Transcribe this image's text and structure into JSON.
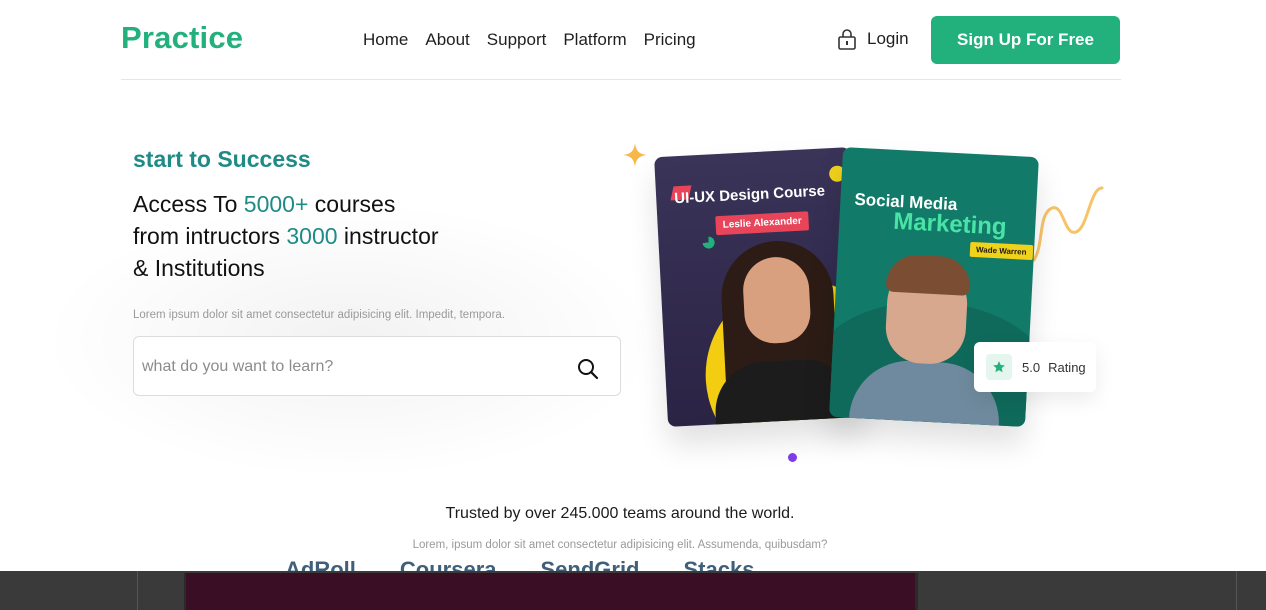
{
  "brand": {
    "logo": "Practice",
    "accent": "#22b07d",
    "teal": "#1f8b86"
  },
  "nav": {
    "items": [
      "Home",
      "About",
      "Support",
      "Platform",
      "Pricing"
    ]
  },
  "header": {
    "login_label": "Login",
    "signup_label": "Sign Up For Free"
  },
  "hero": {
    "tagline": "start to Success",
    "line1_prefix": "Access To ",
    "line1_highlight": "5000+",
    "line1_suffix": " courses",
    "line2_prefix": "from intructors ",
    "line2_highlight": "3000",
    "line2_suffix": " instructor",
    "line3": "& Institutions",
    "description": "Lorem ipsum dolor sit amet consectetur adipisicing elit. Impedit, tempora.",
    "search_placeholder": "what do you want to learn?"
  },
  "cards": [
    {
      "title": "UI-UX Design Course",
      "instructor": "Leslie Alexander"
    },
    {
      "title_line1": "Social Media",
      "title_line2": "Marketing",
      "instructor": "Wade Warren"
    }
  ],
  "rating": {
    "value": "5.0",
    "label": "Rating"
  },
  "trusted": {
    "headline": "Trusted by over 245.000 teams around the world.",
    "description": "Lorem, ipsum dolor sit amet consectetur adipisicing elit. Assumenda, quibusdam?",
    "logos": [
      "AdRoll",
      "Coursera",
      "SendGrid",
      "Stacks"
    ]
  },
  "icons": {
    "lock": "lock-icon",
    "search": "search-icon",
    "star": "star-icon",
    "sparkle": "sparkle-icon"
  }
}
